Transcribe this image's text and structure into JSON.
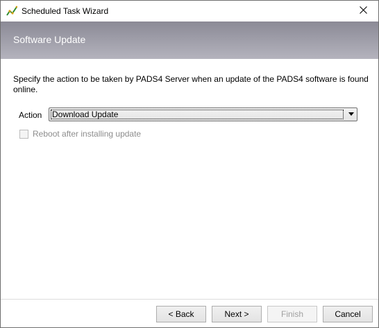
{
  "window": {
    "title": "Scheduled Task Wizard",
    "icon": "chart-line-icon",
    "close_icon": "close-icon"
  },
  "banner": {
    "title": "Software Update"
  },
  "main": {
    "description": "Specify the action to be taken by PADS4 Server when an update of the PADS4 software is found online.",
    "action_label": "Action",
    "action_value": "Download Update",
    "reboot_label": "Reboot after installing update",
    "reboot_checked": false,
    "reboot_enabled": false
  },
  "footer": {
    "back_label": "< Back",
    "next_label": "Next >",
    "finish_label": "Finish",
    "cancel_label": "Cancel",
    "finish_enabled": false
  },
  "colors": {
    "banner_top": "#8b8a96",
    "banner_bottom": "#b4b3bd",
    "disabled_text": "#8d8d8d",
    "icon_line": "#2e8b2e",
    "icon_dot": "#d4a017"
  }
}
